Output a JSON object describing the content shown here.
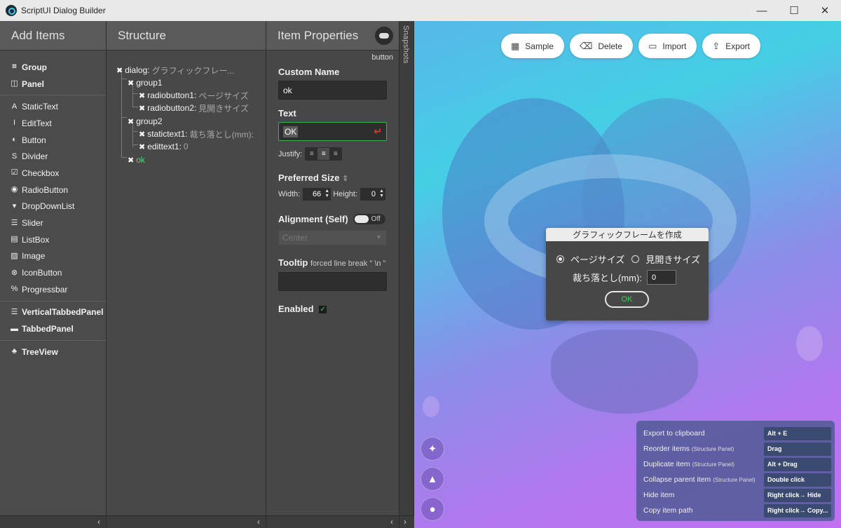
{
  "window": {
    "title": "ScriptUI Dialog Builder",
    "controls": {
      "minimize": "—",
      "maximize": "☐",
      "close": "✕"
    }
  },
  "add_items": {
    "header": "Add Items",
    "groups": [
      [
        {
          "label": "Group",
          "icon": "group-icon",
          "glyph": "⌗",
          "bold": true
        },
        {
          "label": "Panel",
          "icon": "panel-icon",
          "glyph": "◫",
          "bold": true
        }
      ],
      [
        {
          "label": "StaticText",
          "icon": "static-text-icon",
          "glyph": "A"
        },
        {
          "label": "EditText",
          "icon": "edit-text-icon",
          "glyph": "I"
        },
        {
          "label": "Button",
          "icon": "button-icon",
          "glyph": "◐"
        },
        {
          "label": "Divider",
          "icon": "divider-icon",
          "glyph": "S"
        },
        {
          "label": "Checkbox",
          "icon": "checkbox-icon",
          "glyph": "☑"
        },
        {
          "label": "RadioButton",
          "icon": "radio-button-icon",
          "glyph": "◉"
        },
        {
          "label": "DropDownList",
          "icon": "dropdown-list-icon",
          "glyph": "▾"
        },
        {
          "label": "Slider",
          "icon": "slider-icon",
          "glyph": "☰"
        },
        {
          "label": "ListBox",
          "icon": "list-box-icon",
          "glyph": "▤"
        },
        {
          "label": "Image",
          "icon": "image-icon",
          "glyph": "▨"
        },
        {
          "label": "IconButton",
          "icon": "icon-button-icon",
          "glyph": "⊗"
        },
        {
          "label": "Progressbar",
          "icon": "progressbar-icon",
          "glyph": "%"
        }
      ],
      [
        {
          "label": "VerticalTabbedPanel",
          "icon": "vertical-tabbed-panel-icon",
          "glyph": "☰",
          "bold": true
        },
        {
          "label": "TabbedPanel",
          "icon": "tabbed-panel-icon",
          "glyph": "▬",
          "bold": true
        }
      ],
      [
        {
          "label": "TreeView",
          "icon": "tree-view-icon",
          "glyph": "♣",
          "bold": true
        }
      ]
    ],
    "collapse_icon": "‹"
  },
  "structure": {
    "header": "Structure",
    "nodes": {
      "dialog": {
        "key": "dialog:",
        "value": "グラフィックフレー..."
      },
      "group1": {
        "key": "group1",
        "value": ""
      },
      "radiobutton1": {
        "key": "radiobutton1:",
        "value": "ページサイズ"
      },
      "radiobutton2": {
        "key": "radiobutton2:",
        "value": "見開きサイズ"
      },
      "group2": {
        "key": "group2",
        "value": ""
      },
      "statictext1": {
        "key": "statictext1:",
        "value": "裁ち落とし(mm):"
      },
      "edittext1": {
        "key": "edittext1:",
        "value": "0"
      },
      "ok": {
        "key": "ok",
        "value": ""
      }
    },
    "remove_glyph": "✖",
    "collapse_icon": "‹"
  },
  "properties": {
    "header": "Item Properties",
    "type": "button",
    "custom_name_label": "Custom Name",
    "custom_name_value": "ok",
    "text_label": "Text",
    "text_value": "OK",
    "enter_glyph": "↵",
    "justify_label": "Justify:",
    "justify_selected": "center",
    "preferred_size_label": "Preferred Size",
    "preferred_size_glyph": "⇕",
    "width_label": "Width:",
    "width_value": "66",
    "height_label": "Height:",
    "height_value": "0",
    "alignment_label": "Alignment (Self)",
    "alignment_switch": "Off",
    "alignment_value": "Center",
    "tooltip_label": "Tooltip",
    "tooltip_hint": "forced line break \" \\n \"",
    "tooltip_value": "",
    "enabled_label": "Enabled",
    "enabled_checked": true,
    "check_glyph": "✓",
    "collapse_icons": {
      "left": "‹",
      "right": "›"
    }
  },
  "snapshots": {
    "label": "Snapshots"
  },
  "toolbar": {
    "sample": "Sample",
    "delete": "Delete",
    "import": "Import",
    "export": "Export",
    "icons": {
      "sample": "▦",
      "delete": "🗑",
      "import": "▭",
      "export": "⇪"
    }
  },
  "preview_dialog": {
    "title": "グラフィックフレームを作成",
    "radio1": "ページサイズ",
    "radio1_selected": true,
    "radio2": "見開きサイズ",
    "radio2_selected": false,
    "bleed_label": "裁ち落とし(mm):",
    "bleed_value": "0",
    "ok": "OK"
  },
  "side_icons": [
    {
      "name": "lightbulb-icon",
      "glyph": "💡"
    },
    {
      "name": "graduation-cap-icon",
      "glyph": "🎓"
    },
    {
      "name": "github-icon",
      "glyph": "◉"
    }
  ],
  "shortcuts": [
    {
      "action": "Export to clipboard",
      "context": "",
      "key": "Alt + E"
    },
    {
      "action": "Reorder items",
      "context": "(Structure Panel)",
      "key": "Drag"
    },
    {
      "action": "Duplicate item",
      "context": "(Structure Panel)",
      "key": "Alt + Drag"
    },
    {
      "action": "Collapse parent item",
      "context": "(Structure Panel)",
      "key": "Double click"
    },
    {
      "action": "Hide item",
      "context": "",
      "key": "Right click→ Hide"
    },
    {
      "action": "Copy item path",
      "context": "",
      "key": "Right click→ Copy..."
    }
  ],
  "colors": {
    "accent_green": "#3fd15a",
    "panel_bg": "#4a4a4a",
    "canvas_gradient_start": "#57b7e8",
    "canvas_gradient_end": "#c070f0"
  }
}
